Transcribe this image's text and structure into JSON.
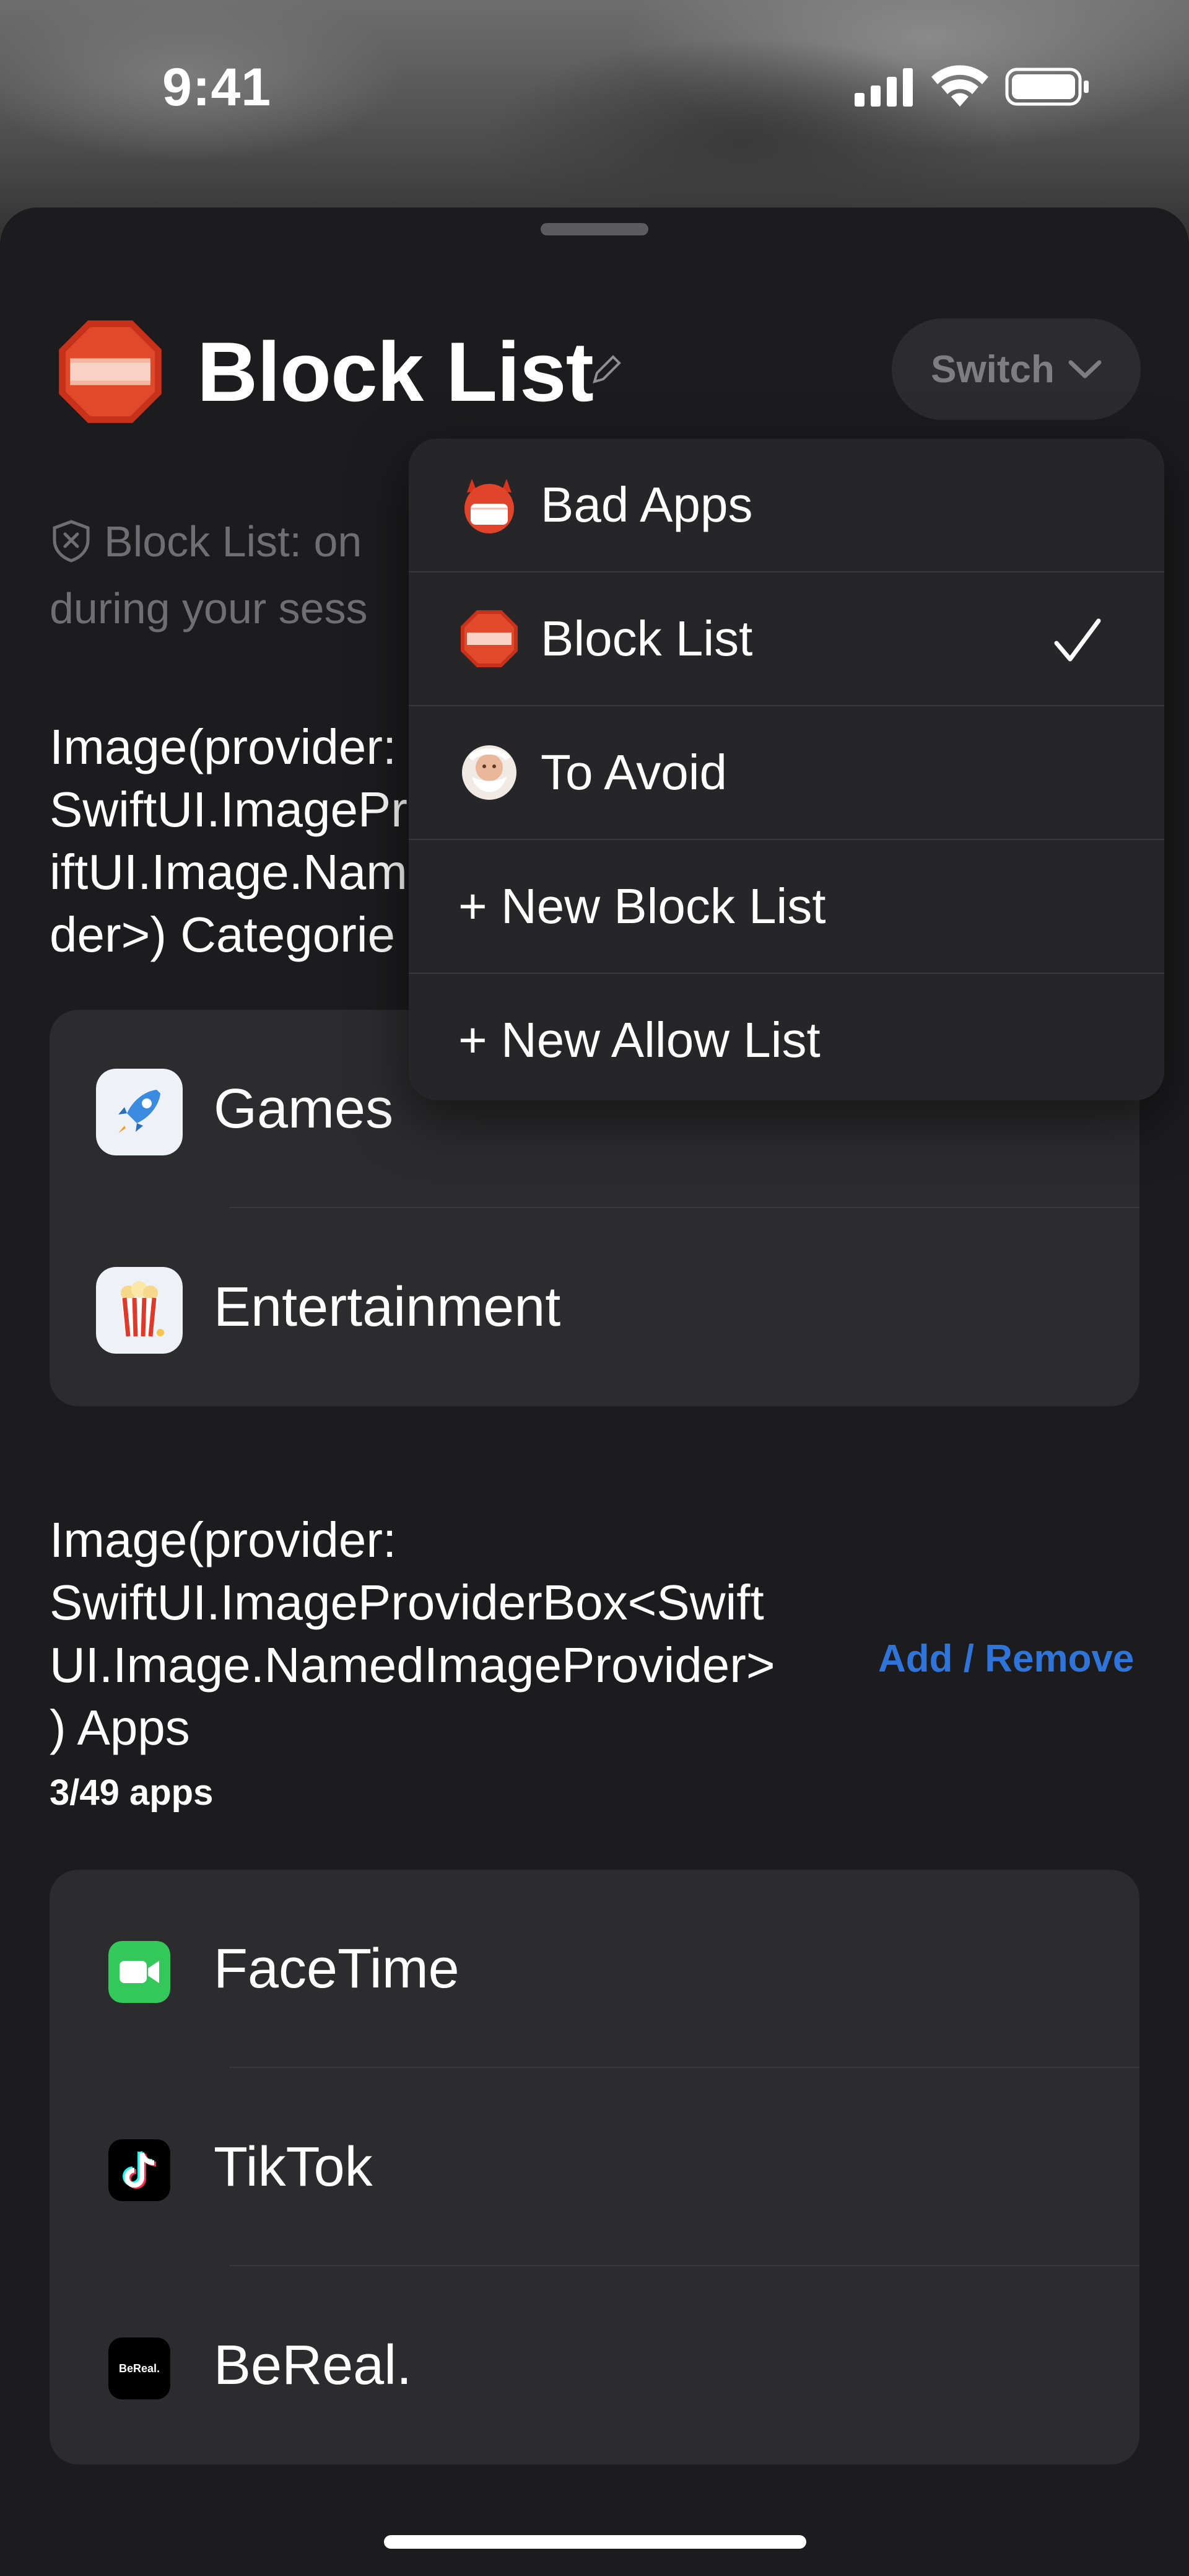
{
  "status_bar": {
    "time": "9:41"
  },
  "header": {
    "title": "Block List",
    "icon": "stop-sign-icon",
    "switch_label": "Switch"
  },
  "info_text": "Block List: only the apps below are blocked during your session",
  "info_visible": [
    "Block List: on",
    "during your sess"
  ],
  "categories_section": {
    "heading_lines": [
      "Image(provider:",
      "SwiftUI.ImagePr",
      "iftUI.Image.Nam",
      "der>) Categorie"
    ],
    "items": [
      {
        "label": "Games",
        "icon": "rocket-icon"
      },
      {
        "label": "Entertainment",
        "icon": "popcorn-icon"
      }
    ]
  },
  "apps_section": {
    "heading_lines": [
      "Image(provider:",
      "SwiftUI.ImageProviderBox<Swift",
      "UI.Image.NamedImageProvider>",
      ") Apps"
    ],
    "action_label": "Add / Remove",
    "count_label": "3/49 apps",
    "items": [
      {
        "label": "FaceTime",
        "icon": "facetime-icon"
      },
      {
        "label": "TikTok",
        "icon": "tiktok-icon"
      },
      {
        "label": "BeReal.",
        "icon": "bereal-icon",
        "icon_text": "BeReal."
      }
    ]
  },
  "switch_menu": {
    "items": [
      {
        "label": "Bad Apps",
        "icon": "devil-face-icon"
      },
      {
        "label": "Block List",
        "icon": "stop-sign-icon",
        "selected": true
      },
      {
        "label": "To Avoid",
        "icon": "santa-face-icon"
      },
      {
        "label": "+ New Block List"
      },
      {
        "label": "+ New Allow List"
      }
    ]
  },
  "colors": {
    "background": "#1c1c1e",
    "card": "#2c2c2e",
    "accent": "#2f74d8",
    "stop_red": "#d73a1e"
  }
}
